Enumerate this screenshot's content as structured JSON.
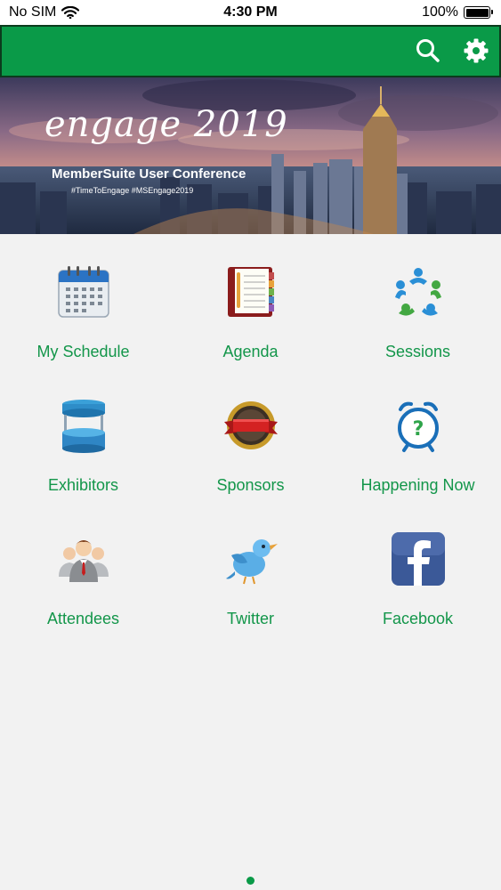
{
  "status_bar": {
    "carrier": "No SIM",
    "time": "4:30 PM",
    "battery": "100%",
    "battery_level": 1.0
  },
  "nav_bar": {
    "color": "#0a9a48",
    "icons": [
      "search-icon",
      "gear-icon"
    ]
  },
  "banner": {
    "title": "engage 2019",
    "subtitle": "MemberSuite User Conference",
    "hashtags": "#TimeToEngage #MSEngage2019"
  },
  "tiles": [
    {
      "label": "My Schedule",
      "icon": "calendar-icon"
    },
    {
      "label": "Agenda",
      "icon": "notebook-icon"
    },
    {
      "label": "Sessions",
      "icon": "people-circle-icon"
    },
    {
      "label": "Exhibitors",
      "icon": "booth-icon"
    },
    {
      "label": "Sponsors",
      "icon": "badge-ribbon-icon"
    },
    {
      "label": "Happening Now",
      "icon": "alarm-clock-icon"
    },
    {
      "label": "Attendees",
      "icon": "business-people-icon"
    },
    {
      "label": "Twitter",
      "icon": "bird-icon"
    },
    {
      "label": "Facebook",
      "icon": "facebook-icon"
    }
  ],
  "page_indicator": {
    "current": 1,
    "total": 1
  },
  "colors": {
    "accent": "#0a9a48",
    "label": "#13964a",
    "background": "#f2f2f2"
  }
}
